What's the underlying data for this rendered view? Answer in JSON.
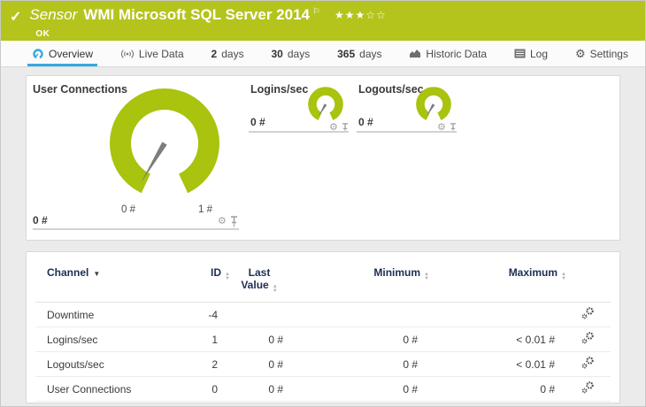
{
  "colors": {
    "brand-green": "#b4c41d",
    "gauge-green": "#a9c30e",
    "accent-blue": "#36a9e1",
    "navy": "#1c2e52",
    "needle": "#7d7d7d"
  },
  "glyphs": {
    "check": "✓",
    "flag": "⚐",
    "stars_filled": "★★★",
    "stars_empty": "☆☆",
    "gear": "⚙",
    "sort_asc": "▲",
    "sort_desc": "▼",
    "sort_active": "▼"
  },
  "header": {
    "sensor_label": "Sensor",
    "title": "WMI Microsoft SQL Server 2014",
    "status": "OK",
    "rating": "3 of 5 stars"
  },
  "tabs": [
    {
      "label": "Overview",
      "icon": "gauge-icon",
      "active": true
    },
    {
      "label": "Live Data",
      "icon": "broadcast-icon"
    },
    {
      "num": "2",
      "label": "days"
    },
    {
      "num": "30",
      "label": "days"
    },
    {
      "num": "365",
      "label": "days"
    },
    {
      "label": "Historic Data",
      "icon": "area-chart-icon"
    },
    {
      "label": "Log",
      "icon": "log-icon"
    },
    {
      "label": "Settings",
      "icon": "gear-icon"
    }
  ],
  "gauges": {
    "user_connections": {
      "title": "User Connections",
      "value": "0 #",
      "scale_min": "0 #",
      "scale_max": "1 #",
      "needle_at": 0
    },
    "logins": {
      "title": "Logins/sec",
      "value": "0 #",
      "needle_at": 0
    },
    "logouts": {
      "title": "Logouts/sec",
      "value": "0 #",
      "needle_at": 0
    }
  },
  "table": {
    "columns": {
      "channel": "Channel",
      "id": "ID",
      "last_line1": "Last",
      "last_line2": "Value",
      "minimum": "Minimum",
      "maximum": "Maximum"
    },
    "rows": [
      {
        "channel": "Downtime",
        "id": "-4",
        "last": "",
        "min": "",
        "max": ""
      },
      {
        "channel": "Logins/sec",
        "id": "1",
        "last": "0 #",
        "min": "0 #",
        "max": "< 0.01 #"
      },
      {
        "channel": "Logouts/sec",
        "id": "2",
        "last": "0 #",
        "min": "0 #",
        "max": "< 0.01 #"
      },
      {
        "channel": "User Connections",
        "id": "0",
        "last": "0 #",
        "min": "0 #",
        "max": "0 #"
      }
    ]
  }
}
